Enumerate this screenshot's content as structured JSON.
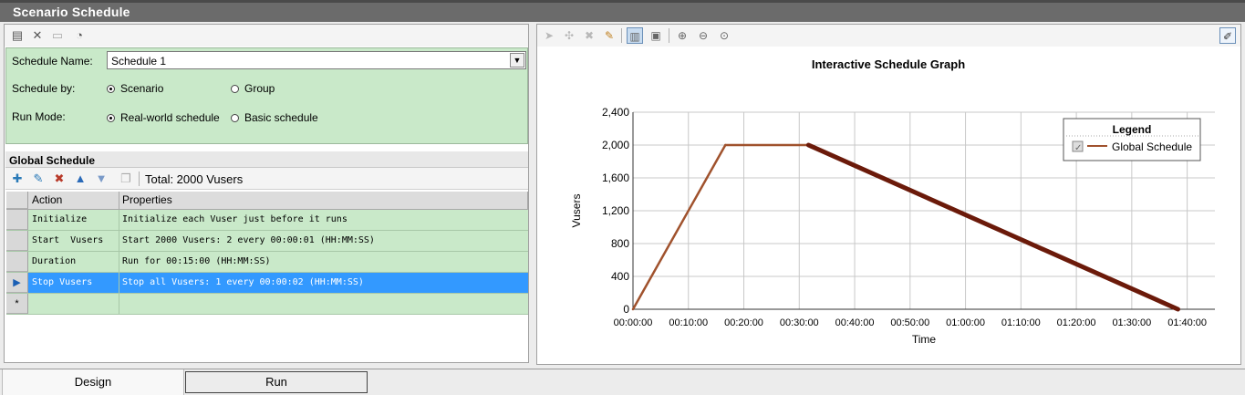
{
  "window": {
    "title": "Scenario Schedule"
  },
  "settings": {
    "schedule_name_label": "Schedule Name:",
    "schedule_name_value": "Schedule 1",
    "schedule_by_label": "Schedule by:",
    "schedule_by_options": [
      "Scenario",
      "Group"
    ],
    "schedule_by_selected": "Scenario",
    "run_mode_label": "Run Mode:",
    "run_mode_options": [
      "Real-world schedule",
      "Basic schedule"
    ],
    "run_mode_selected": "Real-world schedule"
  },
  "global_schedule": {
    "title": "Global Schedule",
    "total": "Total: 2000 Vusers",
    "columns": [
      "Action",
      "Properties"
    ],
    "rows": [
      {
        "action": "Initialize",
        "properties": "Initialize each Vuser just before it runs",
        "selected": false
      },
      {
        "action": "Start  Vusers",
        "properties": "Start 2000 Vusers: 2 every 00:00:01 (HH:MM:SS)",
        "selected": false
      },
      {
        "action": "Duration",
        "properties": "Run for 00:15:00 (HH:MM:SS)",
        "selected": false
      },
      {
        "action": "Stop Vusers",
        "properties": "Stop all Vusers: 1 every 00:00:02 (HH:MM:SS)",
        "selected": true
      }
    ],
    "new_row_marker": "*"
  },
  "chart_data": {
    "type": "line",
    "title": "Interactive Schedule Graph",
    "xlabel": "Time",
    "ylabel": "Vusers",
    "x_ticks": [
      "00:00:00",
      "00:10:00",
      "00:20:00",
      "00:30:00",
      "00:40:00",
      "00:50:00",
      "01:00:00",
      "01:10:00",
      "01:20:00",
      "01:30:00",
      "01:40:00"
    ],
    "y_ticks": [
      "0",
      "400",
      "800",
      "1,200",
      "1,600",
      "2,000",
      "2,400"
    ],
    "xlim_minutes": [
      0,
      105
    ],
    "ylim": [
      0,
      2400
    ],
    "grid": true,
    "legend": {
      "title": "Legend",
      "position": "top-right"
    },
    "series": [
      {
        "name": "Global Schedule",
        "color": "#a0522d",
        "highlight_color": "#6b1a0a",
        "points_minutes": [
          [
            0,
            0
          ],
          [
            16.67,
            2000
          ],
          [
            31.67,
            2000
          ],
          [
            98.33,
            0
          ]
        ],
        "highlight_segment": [
          2,
          3
        ]
      }
    ]
  },
  "tabs": [
    "Design",
    "Run"
  ],
  "active_tab": "Design"
}
